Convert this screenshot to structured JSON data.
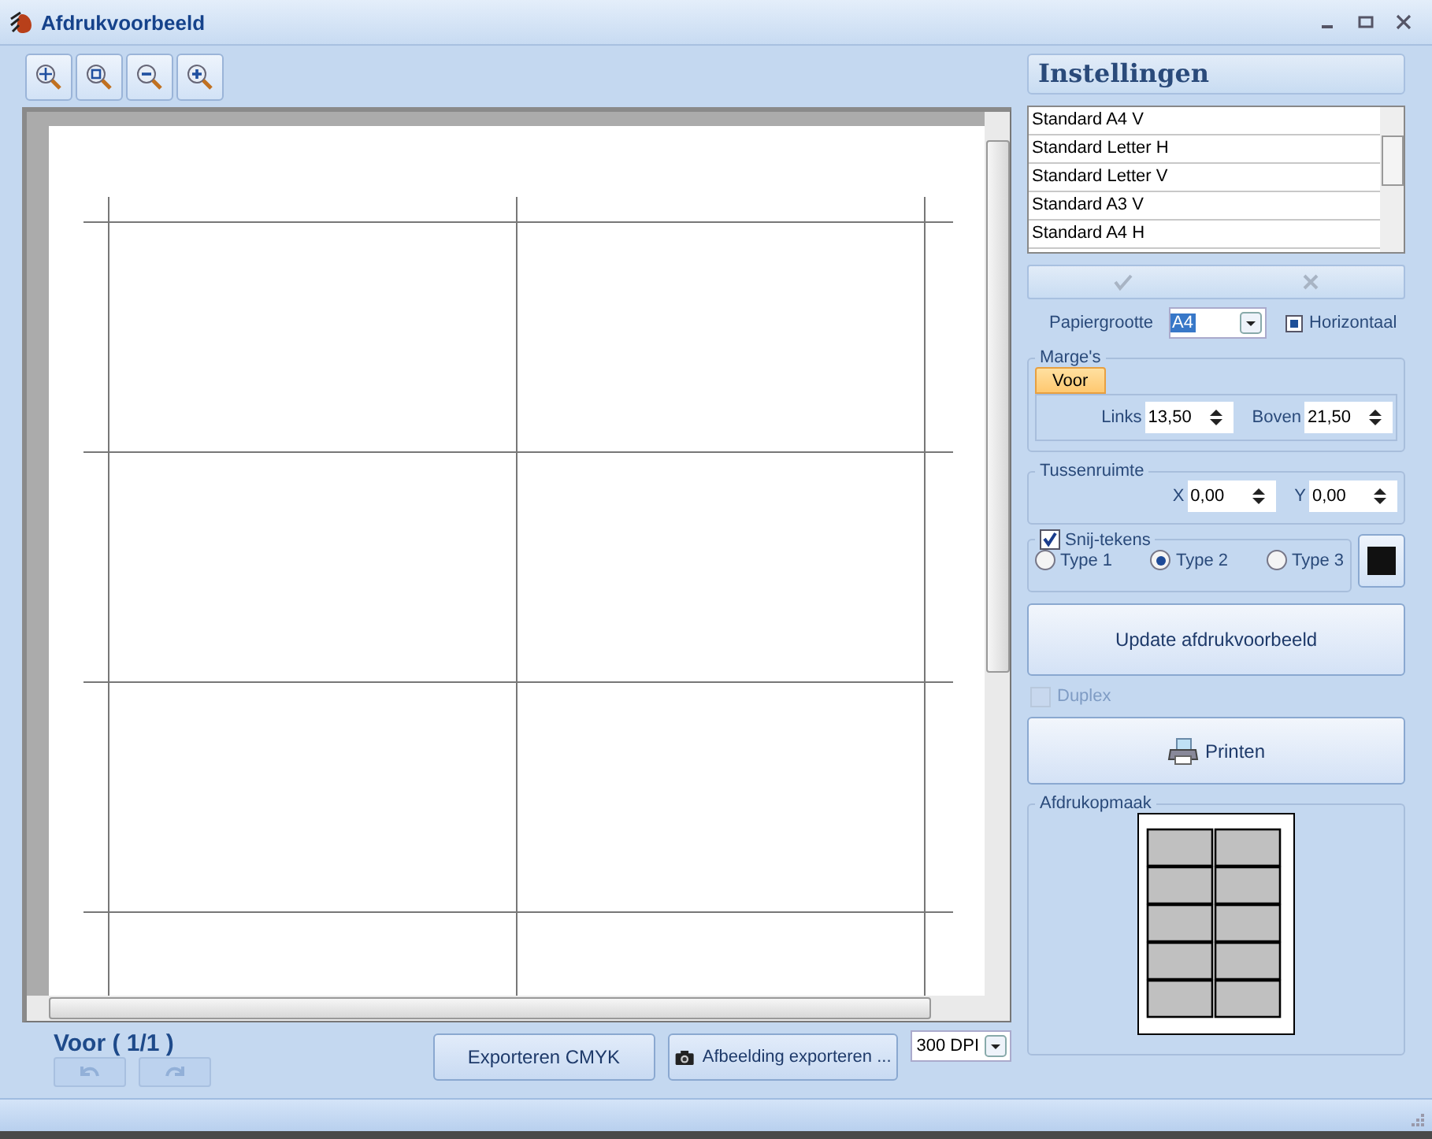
{
  "window": {
    "title": "Afdrukvoorbeeld"
  },
  "toolbar": [
    {
      "kind": "zoom-fit"
    },
    {
      "kind": "zoom-page"
    },
    {
      "kind": "zoom-out"
    },
    {
      "kind": "zoom-in"
    }
  ],
  "preview": {
    "kind": "label-sheet"
  },
  "page_nav": {
    "label": "Voor ( 1/1 )",
    "undo_disabled": true,
    "redo_disabled": true
  },
  "export_buttons": [
    {
      "kind": "plain",
      "label": "Exporteren CMYK"
    },
    {
      "kind": "camera",
      "label": "Afbeelding exporteren ..."
    }
  ],
  "dpi": {
    "value": "300 DPI"
  },
  "settings": {
    "title": "Instellingen",
    "presets": [
      {
        "label": "Standard A4 V",
        "selected": false
      },
      {
        "label": "Standard Letter H",
        "selected": false
      },
      {
        "label": "Standard Letter V",
        "selected": false
      },
      {
        "label": "Standard A3 V",
        "selected": false
      },
      {
        "label": "Standard A4 H",
        "selected": false
      }
    ],
    "paper_size": {
      "label": "Papiergrootte",
      "value": "A4"
    },
    "horizontal": {
      "label": "Horizontaal",
      "checked": true
    },
    "margins": {
      "legend": "Marge's",
      "tabs": [
        {
          "label": "Voor",
          "selected": true
        }
      ],
      "fields": [
        {
          "label": "Links",
          "value": "13,50"
        },
        {
          "label": "Boven",
          "value": "21,50"
        }
      ]
    },
    "spacing": {
      "legend": "Tussenruimte",
      "fields": [
        {
          "label": "X",
          "value": "0,00"
        },
        {
          "label": "Y",
          "value": "0,00"
        }
      ]
    },
    "cut_marks": {
      "label": "Snij-tekens",
      "checked": true,
      "color": "#111111",
      "types": [
        {
          "label": "Type 1",
          "selected": false
        },
        {
          "label": "Type 2",
          "selected": true
        },
        {
          "label": "Type 3",
          "selected": false
        }
      ]
    },
    "update_button": "Update afdrukvoorbeeld",
    "duplex": {
      "label": "Duplex",
      "checked": false,
      "disabled": true
    },
    "print_button": "Printen",
    "layout_legend": "Afdrukopmaak"
  }
}
